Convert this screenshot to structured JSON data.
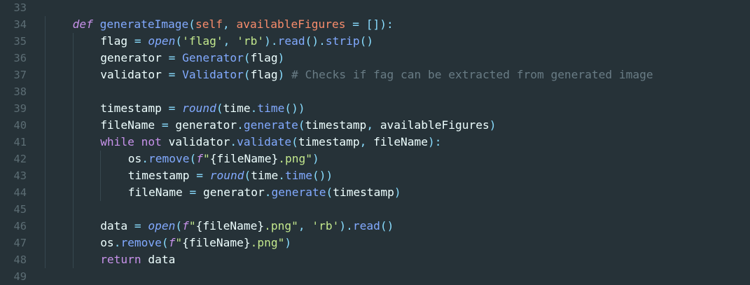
{
  "editor": {
    "lines": [
      {
        "number": "33",
        "indent": 0,
        "tokens": []
      },
      {
        "number": "34",
        "indent": 1,
        "tokens": [
          {
            "t": "def",
            "c": "def"
          },
          {
            "t": " ",
            "c": "ident"
          },
          {
            "t": "generateImage",
            "c": "func"
          },
          {
            "t": "(",
            "c": "punct"
          },
          {
            "t": "self",
            "c": "param"
          },
          {
            "t": ", ",
            "c": "punct"
          },
          {
            "t": "availableFigures",
            "c": "param"
          },
          {
            "t": " ",
            "c": "ident"
          },
          {
            "t": "=",
            "c": "op"
          },
          {
            "t": " ",
            "c": "ident"
          },
          {
            "t": "[]",
            "c": "punct"
          },
          {
            "t": "):",
            "c": "punct"
          }
        ]
      },
      {
        "number": "35",
        "indent": 2,
        "tokens": [
          {
            "t": "flag",
            "c": "ident"
          },
          {
            "t": " ",
            "c": "ident"
          },
          {
            "t": "=",
            "c": "op"
          },
          {
            "t": " ",
            "c": "ident"
          },
          {
            "t": "open",
            "c": "builtin"
          },
          {
            "t": "(",
            "c": "punct"
          },
          {
            "t": "'flag'",
            "c": "str"
          },
          {
            "t": ", ",
            "c": "punct"
          },
          {
            "t": "'rb'",
            "c": "str"
          },
          {
            "t": ")",
            "c": "punct"
          },
          {
            "t": ".",
            "c": "punct"
          },
          {
            "t": "read",
            "c": "method"
          },
          {
            "t": "()",
            "c": "punct"
          },
          {
            "t": ".",
            "c": "punct"
          },
          {
            "t": "strip",
            "c": "method"
          },
          {
            "t": "()",
            "c": "punct"
          }
        ]
      },
      {
        "number": "36",
        "indent": 2,
        "tokens": [
          {
            "t": "generator",
            "c": "ident"
          },
          {
            "t": " ",
            "c": "ident"
          },
          {
            "t": "=",
            "c": "op"
          },
          {
            "t": " ",
            "c": "ident"
          },
          {
            "t": "Generator",
            "c": "class"
          },
          {
            "t": "(",
            "c": "punct"
          },
          {
            "t": "flag",
            "c": "ident"
          },
          {
            "t": ")",
            "c": "punct"
          }
        ]
      },
      {
        "number": "37",
        "indent": 2,
        "tokens": [
          {
            "t": "validator",
            "c": "ident"
          },
          {
            "t": " ",
            "c": "ident"
          },
          {
            "t": "=",
            "c": "op"
          },
          {
            "t": " ",
            "c": "ident"
          },
          {
            "t": "Validator",
            "c": "class"
          },
          {
            "t": "(",
            "c": "punct"
          },
          {
            "t": "flag",
            "c": "ident"
          },
          {
            "t": ")",
            "c": "punct"
          },
          {
            "t": " ",
            "c": "ident"
          },
          {
            "t": "# Checks if fag can be extracted from generated image",
            "c": "comment"
          }
        ]
      },
      {
        "number": "38",
        "indent": 2,
        "tokens": []
      },
      {
        "number": "39",
        "indent": 2,
        "tokens": [
          {
            "t": "timestamp",
            "c": "ident"
          },
          {
            "t": " ",
            "c": "ident"
          },
          {
            "t": "=",
            "c": "op"
          },
          {
            "t": " ",
            "c": "ident"
          },
          {
            "t": "round",
            "c": "builtin"
          },
          {
            "t": "(",
            "c": "punct"
          },
          {
            "t": "time",
            "c": "ident"
          },
          {
            "t": ".",
            "c": "punct"
          },
          {
            "t": "time",
            "c": "method"
          },
          {
            "t": "())",
            "c": "punct"
          }
        ]
      },
      {
        "number": "40",
        "indent": 2,
        "tokens": [
          {
            "t": "fileName",
            "c": "ident"
          },
          {
            "t": " ",
            "c": "ident"
          },
          {
            "t": "=",
            "c": "op"
          },
          {
            "t": " ",
            "c": "ident"
          },
          {
            "t": "generator",
            "c": "ident"
          },
          {
            "t": ".",
            "c": "punct"
          },
          {
            "t": "generate",
            "c": "method"
          },
          {
            "t": "(",
            "c": "punct"
          },
          {
            "t": "timestamp",
            "c": "ident"
          },
          {
            "t": ", ",
            "c": "punct"
          },
          {
            "t": "availableFigures",
            "c": "ident"
          },
          {
            "t": ")",
            "c": "punct"
          }
        ]
      },
      {
        "number": "41",
        "indent": 2,
        "tokens": [
          {
            "t": "while",
            "c": "keyword"
          },
          {
            "t": " ",
            "c": "ident"
          },
          {
            "t": "not",
            "c": "keyword"
          },
          {
            "t": " ",
            "c": "ident"
          },
          {
            "t": "validator",
            "c": "ident"
          },
          {
            "t": ".",
            "c": "punct"
          },
          {
            "t": "validate",
            "c": "method"
          },
          {
            "t": "(",
            "c": "punct"
          },
          {
            "t": "timestamp",
            "c": "ident"
          },
          {
            "t": ", ",
            "c": "punct"
          },
          {
            "t": "fileName",
            "c": "ident"
          },
          {
            "t": "):",
            "c": "punct"
          }
        ]
      },
      {
        "number": "42",
        "indent": 3,
        "tokens": [
          {
            "t": "os",
            "c": "ident"
          },
          {
            "t": ".",
            "c": "punct"
          },
          {
            "t": "remove",
            "c": "method"
          },
          {
            "t": "(",
            "c": "punct"
          },
          {
            "t": "f",
            "c": "fprefix"
          },
          {
            "t": "\"",
            "c": "str"
          },
          {
            "t": "{fileName}",
            "c": "ident"
          },
          {
            "t": ".png\"",
            "c": "str"
          },
          {
            "t": ")",
            "c": "punct"
          }
        ]
      },
      {
        "number": "43",
        "indent": 3,
        "tokens": [
          {
            "t": "timestamp",
            "c": "ident"
          },
          {
            "t": " ",
            "c": "ident"
          },
          {
            "t": "=",
            "c": "op"
          },
          {
            "t": " ",
            "c": "ident"
          },
          {
            "t": "round",
            "c": "builtin"
          },
          {
            "t": "(",
            "c": "punct"
          },
          {
            "t": "time",
            "c": "ident"
          },
          {
            "t": ".",
            "c": "punct"
          },
          {
            "t": "time",
            "c": "method"
          },
          {
            "t": "())",
            "c": "punct"
          }
        ]
      },
      {
        "number": "44",
        "indent": 3,
        "tokens": [
          {
            "t": "fileName",
            "c": "ident"
          },
          {
            "t": " ",
            "c": "ident"
          },
          {
            "t": "=",
            "c": "op"
          },
          {
            "t": " ",
            "c": "ident"
          },
          {
            "t": "generator",
            "c": "ident"
          },
          {
            "t": ".",
            "c": "punct"
          },
          {
            "t": "generate",
            "c": "method"
          },
          {
            "t": "(",
            "c": "punct"
          },
          {
            "t": "timestamp",
            "c": "ident"
          },
          {
            "t": ")",
            "c": "punct"
          }
        ]
      },
      {
        "number": "45",
        "indent": 2,
        "tokens": []
      },
      {
        "number": "46",
        "indent": 2,
        "tokens": [
          {
            "t": "data",
            "c": "ident"
          },
          {
            "t": " ",
            "c": "ident"
          },
          {
            "t": "=",
            "c": "op"
          },
          {
            "t": " ",
            "c": "ident"
          },
          {
            "t": "open",
            "c": "builtin"
          },
          {
            "t": "(",
            "c": "punct"
          },
          {
            "t": "f",
            "c": "fprefix"
          },
          {
            "t": "\"",
            "c": "str"
          },
          {
            "t": "{fileName}",
            "c": "ident"
          },
          {
            "t": ".png\"",
            "c": "str"
          },
          {
            "t": ", ",
            "c": "punct"
          },
          {
            "t": "'rb'",
            "c": "str"
          },
          {
            "t": ")",
            "c": "punct"
          },
          {
            "t": ".",
            "c": "punct"
          },
          {
            "t": "read",
            "c": "method"
          },
          {
            "t": "()",
            "c": "punct"
          }
        ]
      },
      {
        "number": "47",
        "indent": 2,
        "tokens": [
          {
            "t": "os",
            "c": "ident"
          },
          {
            "t": ".",
            "c": "punct"
          },
          {
            "t": "remove",
            "c": "method"
          },
          {
            "t": "(",
            "c": "punct"
          },
          {
            "t": "f",
            "c": "fprefix"
          },
          {
            "t": "\"",
            "c": "str"
          },
          {
            "t": "{fileName}",
            "c": "ident"
          },
          {
            "t": ".png\"",
            "c": "str"
          },
          {
            "t": ")",
            "c": "punct"
          }
        ]
      },
      {
        "number": "48",
        "indent": 2,
        "tokens": [
          {
            "t": "return",
            "c": "keyword"
          },
          {
            "t": " ",
            "c": "ident"
          },
          {
            "t": "data",
            "c": "ident"
          }
        ]
      },
      {
        "number": "49",
        "indent": 0,
        "tokens": []
      }
    ]
  },
  "theme": {
    "background": "#263238",
    "keyword": "#c792ea",
    "function": "#82aaff",
    "parameter": "#f78c6c",
    "string": "#c3e88d",
    "operator": "#89ddff",
    "comment": "#697c85",
    "line_number": "#5c6d74"
  }
}
